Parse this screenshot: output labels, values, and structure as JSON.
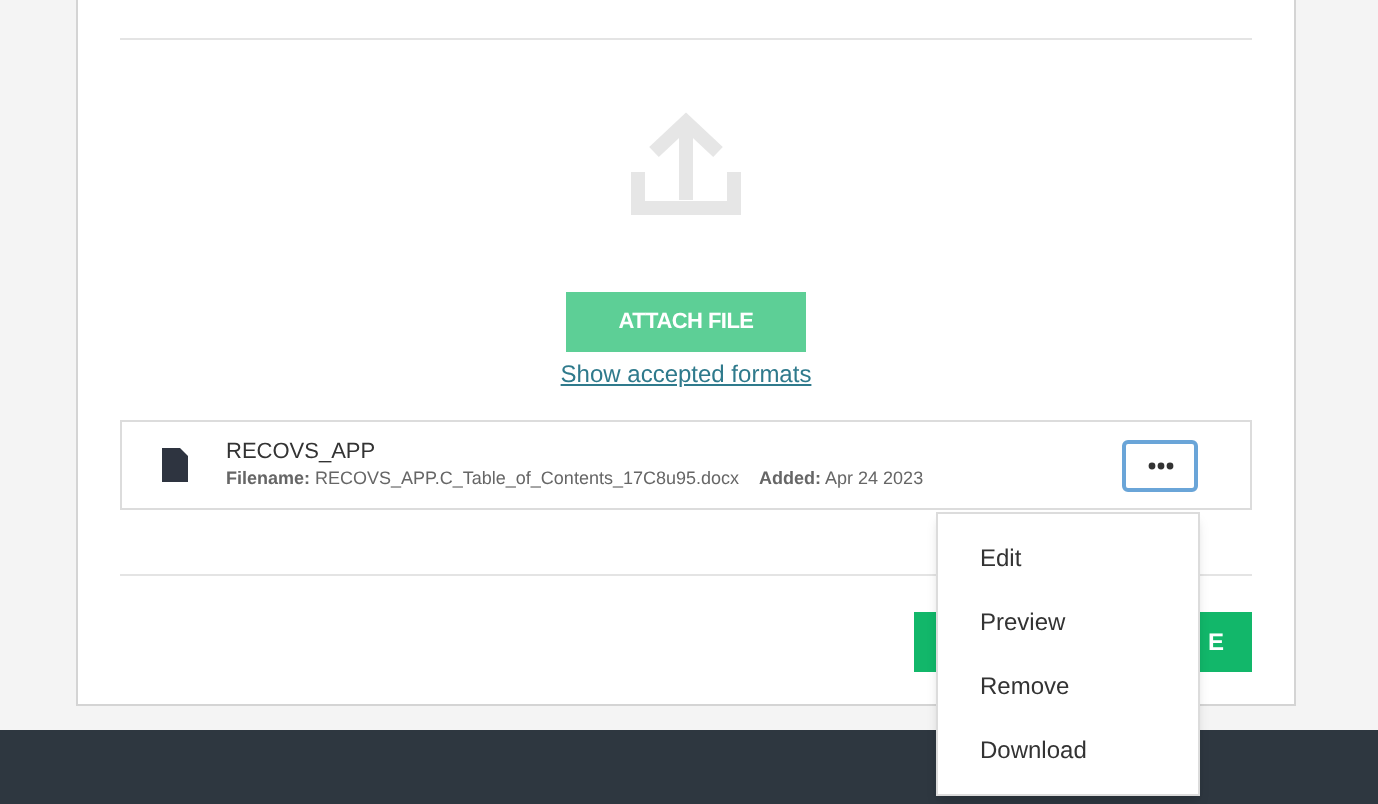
{
  "upload": {
    "button": "ATTACH FILE",
    "link": "Show accepted formats"
  },
  "files": [
    {
      "title": "RECOVS_APP",
      "filename_label": "Filename:",
      "filename": "RECOVS_APP.C_Table_of_Contents_17C8u95.docx",
      "added_label": "Added:",
      "added": "Apr 24 2023",
      "menu_open": true
    }
  ],
  "footer_button": "E",
  "menu": [
    "Edit",
    "Preview",
    "Remove",
    "Download"
  ]
}
